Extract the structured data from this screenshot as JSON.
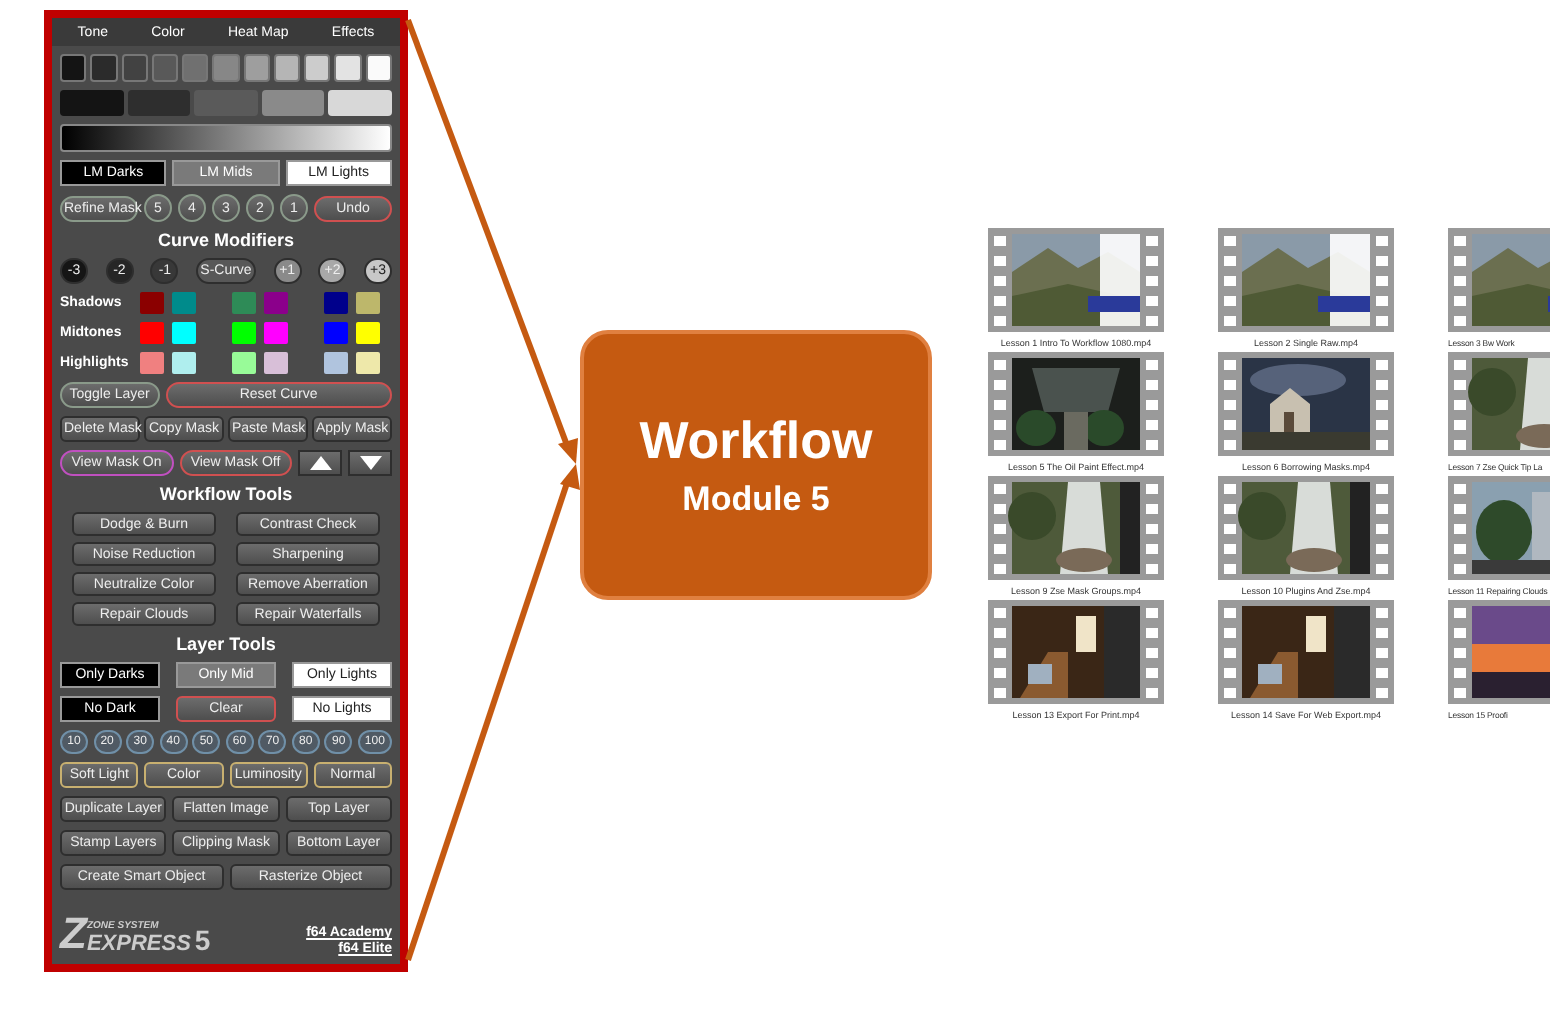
{
  "panel": {
    "tabs": [
      "Tone",
      "Color",
      "Heat Map",
      "Effects"
    ],
    "lm_buttons": [
      {
        "label": "LM Darks",
        "kind": "dark"
      },
      {
        "label": "LM Mids",
        "kind": "mid"
      },
      {
        "label": "LM Lights",
        "kind": "light"
      }
    ],
    "mask_steps": [
      {
        "label": "Refine Mask",
        "kind": "pill"
      },
      {
        "label": "5",
        "kind": "round"
      },
      {
        "label": "4",
        "kind": "round"
      },
      {
        "label": "3",
        "kind": "round"
      },
      {
        "label": "2",
        "kind": "round"
      },
      {
        "label": "1",
        "kind": "round"
      },
      {
        "label": "Undo",
        "kind": "redpill"
      }
    ],
    "curve_title": "Curve Modifiers",
    "curve_buttons": [
      {
        "label": "-3",
        "kind": "shade1"
      },
      {
        "label": "-2",
        "kind": "shade2"
      },
      {
        "label": "-1",
        "kind": "shade3"
      },
      {
        "label": "S-Curve",
        "kind": "shade4"
      },
      {
        "label": "+1",
        "kind": "shade5"
      },
      {
        "label": "+2",
        "kind": "shade6"
      },
      {
        "label": "+3",
        "kind": "shade7"
      }
    ],
    "tone_rows": [
      {
        "label": "Shadows",
        "swatches": [
          {
            "color": "#8b0000"
          },
          {
            "color": "#008b8b"
          },
          {
            "color": "#2e8b57"
          },
          {
            "color": "#8b008b"
          },
          {
            "color": "#00008b"
          },
          {
            "color": "#bdb76b"
          }
        ]
      },
      {
        "label": "Midtones",
        "swatches": [
          {
            "color": "#ff0000"
          },
          {
            "color": "#00ffff"
          },
          {
            "color": "#00ff00"
          },
          {
            "color": "#ff00ff"
          },
          {
            "color": "#0000ff"
          },
          {
            "color": "#ffff00"
          }
        ]
      },
      {
        "label": "Highlights",
        "swatches": [
          {
            "color": "#f08080"
          },
          {
            "color": "#afeeee"
          },
          {
            "color": "#98fb98"
          },
          {
            "color": "#d8bfd8"
          },
          {
            "color": "#b0c4de"
          },
          {
            "color": "#eee8aa"
          }
        ]
      }
    ],
    "curve_actions": [
      {
        "label": "Toggle Layer",
        "kind": "pill"
      },
      {
        "label": "Reset Curve",
        "kind": "redpill"
      }
    ],
    "mask_actions": [
      "Delete Mask",
      "Copy Mask",
      "Paste Mask",
      "Apply Mask"
    ],
    "view_buttons": [
      {
        "label": "View Mask On",
        "kind": "purplepill"
      },
      {
        "label": "View Mask Off",
        "kind": "redpill"
      }
    ],
    "workflow_title": "Workflow Tools",
    "workflow_tools": [
      "Dodge & Burn",
      "Contrast Check",
      "Noise Reduction",
      "Sharpening",
      "Neutralize Color",
      "Remove Aberration",
      "Repair Clouds",
      "Repair Waterfalls"
    ],
    "layer_title": "Layer Tools",
    "layer_rows": [
      [
        {
          "label": "Only Darks",
          "kind": "dark"
        },
        {
          "label": "Only Mid",
          "kind": "mid"
        },
        {
          "label": "Only Lights",
          "kind": "light"
        }
      ],
      [
        {
          "label": "No Dark",
          "kind": "dark"
        },
        {
          "label": "Clear",
          "kind": "red"
        },
        {
          "label": "No Lights",
          "kind": "light"
        }
      ]
    ],
    "opacity_buttons": [
      "10",
      "20",
      "30",
      "40",
      "50",
      "60",
      "70",
      "80",
      "90",
      "100"
    ],
    "blend_buttons": [
      "Soft Light",
      "Color",
      "Luminosity",
      "Normal"
    ],
    "layer_buttons": [
      [
        "Duplicate Layer",
        "Flatten Image",
        "Top Layer"
      ],
      [
        "Stamp Layers",
        "Clipping Mask",
        "Bottom Layer"
      ],
      [
        "Create Smart Object",
        "Rasterize Object"
      ]
    ],
    "logo": {
      "letter": "Z",
      "top": "ZONE SYSTEM",
      "main": "EXPRESS",
      "version": "5"
    },
    "links": [
      "f64 Academy",
      "f64 Elite"
    ]
  },
  "callout": {
    "title": "Workflow",
    "subtitle": "Module 5"
  },
  "videos": [
    {
      "caption": "Lesson 1 Intro To Workflow 1080.mp4"
    },
    {
      "caption": "Lesson 2 Single Raw.mp4"
    },
    {
      "caption": "Lesson 3 Bw Work"
    },
    {
      "caption": "Lesson 5 The Oil Paint Effect.mp4"
    },
    {
      "caption": "Lesson 6 Borrowing Masks.mp4"
    },
    {
      "caption": "Lesson 7 Zse Quick Tip La"
    },
    {
      "caption": "Lesson 9 Zse Mask Groups.mp4"
    },
    {
      "caption": "Lesson 10 Plugins And Zse.mp4"
    },
    {
      "caption": "Lesson 11 Repairing Clouds"
    },
    {
      "caption": "Lesson 13 Export For Print.mp4"
    },
    {
      "caption": "Lesson 14 Save For Web Export.mp4"
    },
    {
      "caption": "Lesson 15 Proofi"
    }
  ]
}
